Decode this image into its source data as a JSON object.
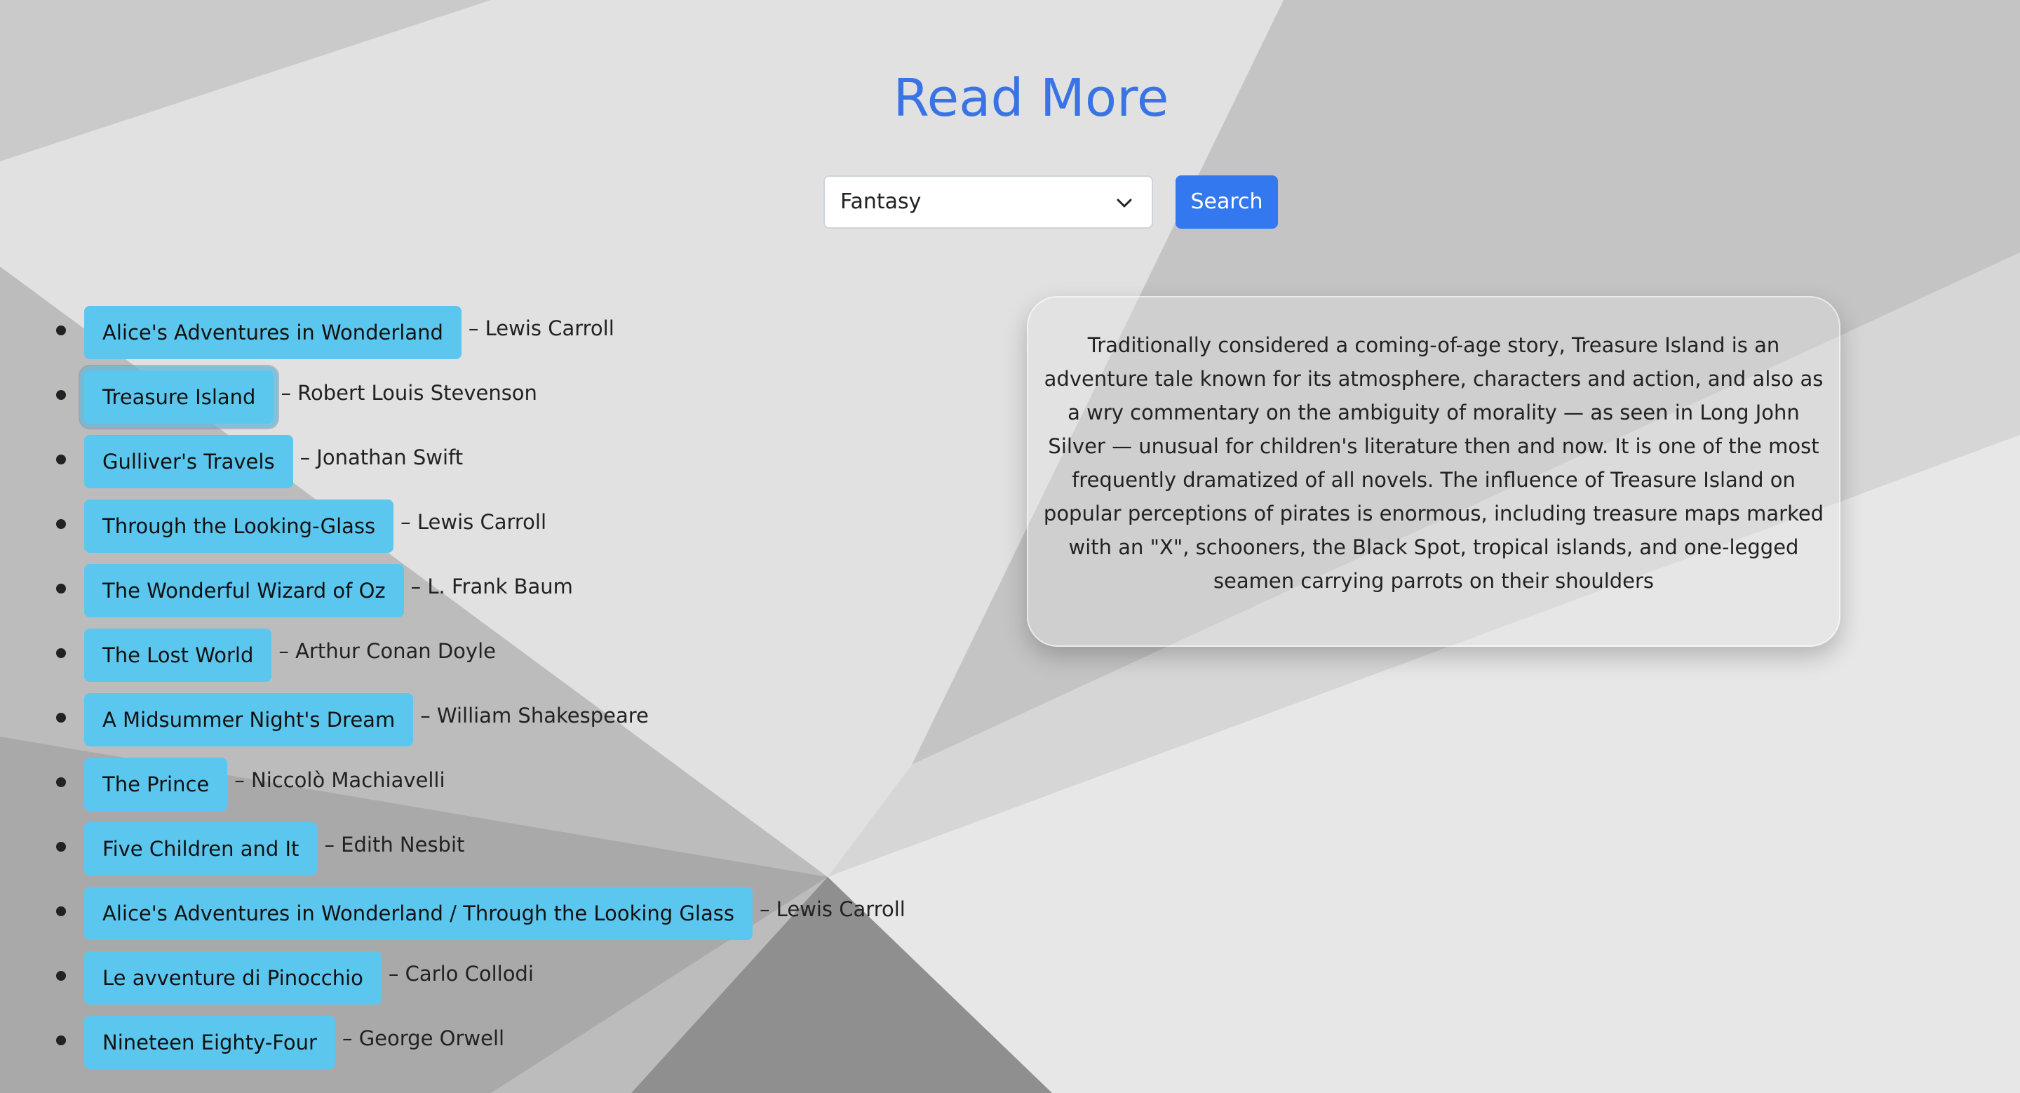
{
  "page": {
    "title": "Read More"
  },
  "filter": {
    "selected_genre": "Fantasy",
    "search_label": "Search"
  },
  "books": [
    {
      "title": "Alice's Adventures in Wonderland",
      "author": "– Lewis Carroll"
    },
    {
      "title": "Treasure Island",
      "author": "– Robert Louis Stevenson"
    },
    {
      "title": "Gulliver's Travels",
      "author": "– Jonathan Swift"
    },
    {
      "title": "Through the Looking-Glass",
      "author": "– Lewis Carroll"
    },
    {
      "title": "The Wonderful Wizard of Oz",
      "author": "– L. Frank Baum"
    },
    {
      "title": "The Lost World",
      "author": "– Arthur Conan Doyle"
    },
    {
      "title": "A Midsummer Night's Dream",
      "author": "– William Shakespeare"
    },
    {
      "title": "The Prince",
      "author": "– Niccolò Machiavelli"
    },
    {
      "title": "Five Children and It",
      "author": "– Edith Nesbit"
    },
    {
      "title": "Alice's Adventures in Wonderland / Through the Looking Glass",
      "author": "– Lewis Carroll"
    },
    {
      "title": "Le avventure di Pinocchio",
      "author": "– Carlo Collodi"
    },
    {
      "title": "Nineteen Eighty-Four",
      "author": "– George Orwell"
    }
  ],
  "description": {
    "text": "Traditionally considered a coming-of-age story, Treasure Island is an adventure tale known for its atmosphere, characters and action, and also as a wry commentary on the ambiguity of morality — as seen in Long John Silver — unusual for children's literature then and now. It is one of the most frequently dramatized of all novels. The influence of Treasure Island on popular perceptions of pirates is enormous, including treasure maps marked with an \"X\", schooners, the Black Spot, tropical islands, and one-legged seamen carrying parrots on their shoulders"
  },
  "colors": {
    "title": "#3a73e6",
    "search_button": "#3478f0",
    "book_tag": "#5cc7ee"
  },
  "icons": {
    "select_chevron": "chevron-down-icon"
  }
}
